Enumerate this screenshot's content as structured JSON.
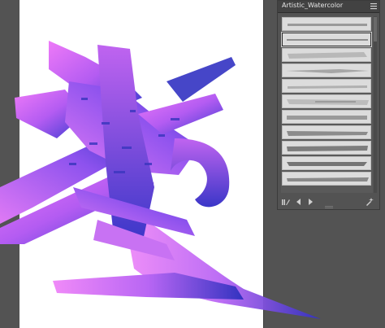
{
  "panel": {
    "title": "Artistic_Watercolor",
    "menu_icon": "panel-menu-icon",
    "brushes": [
      {
        "name": "watercolor-brush-1",
        "selected": false
      },
      {
        "name": "watercolor-brush-2",
        "selected": true
      },
      {
        "name": "watercolor-brush-3",
        "selected": false
      },
      {
        "name": "watercolor-brush-4",
        "selected": false
      },
      {
        "name": "watercolor-brush-5",
        "selected": false
      },
      {
        "name": "watercolor-brush-6",
        "selected": false
      },
      {
        "name": "watercolor-brush-7",
        "selected": false
      },
      {
        "name": "watercolor-brush-8",
        "selected": false
      },
      {
        "name": "watercolor-brush-9",
        "selected": false
      },
      {
        "name": "watercolor-brush-10",
        "selected": false
      },
      {
        "name": "watercolor-brush-11",
        "selected": false
      }
    ],
    "footer_icons": [
      "brush-libraries-menu-icon",
      "previous-library-icon",
      "next-library-icon",
      "brush-options-icon"
    ]
  },
  "colors": {
    "canvas_bg": "#535353",
    "artboard": "#ffffff",
    "gradient_magenta": "#e070f0",
    "gradient_violet": "#9a52f0",
    "gradient_blue": "#3a3ac8"
  }
}
